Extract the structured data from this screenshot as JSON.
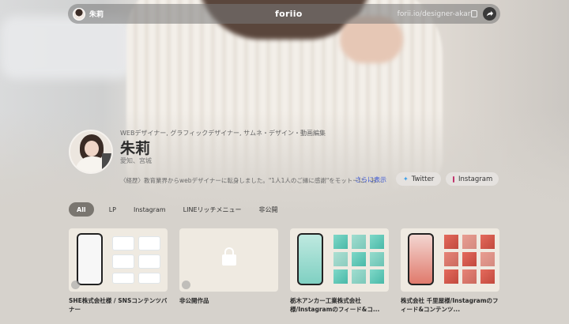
{
  "topbar": {
    "username": "朱莉",
    "logo": "foriio",
    "url": "forii.io/designer-akari"
  },
  "profile": {
    "roles": "WEBデザイナー, グラフィックデザイナー, サムネ・デザイン・動画編集",
    "name": "朱莉",
    "location": "愛知、宮城",
    "bio": "〈経歴〉教育業界からwebデザイナーに転身しました。\"1人1人のご縁に感謝\"をモットーに、お…",
    "more_label": "さらに表示"
  },
  "social": {
    "twitter_label": "Twitter",
    "instagram_label": "Instagram",
    "twitter_color": "#3ea0ea",
    "instagram_color": "#c0346c"
  },
  "tabs": [
    {
      "label": "All",
      "active": true
    },
    {
      "label": "LP",
      "active": false
    },
    {
      "label": "Instagram",
      "active": false
    },
    {
      "label": "LINEリッチメニュー",
      "active": false
    },
    {
      "label": "非公開",
      "active": false
    }
  ],
  "works": [
    {
      "title": "SHE株式会社様 / SNSコンテンツバナー",
      "icon": "pin-icon"
    },
    {
      "title": "非公開作品",
      "icon": "lock-icon"
    },
    {
      "title": "栃木アンカー工業株式会社様/Instagramのフィード&コ...",
      "icon": "phone-mockup"
    },
    {
      "title": "株式会社 千里屋様/Instagramのフィード&コンテンツ...",
      "icon": "phone-mockup"
    }
  ],
  "colors": {
    "accent": "#3b57d6",
    "active_tab": "#7a7670",
    "background": "#d6d2cc"
  }
}
